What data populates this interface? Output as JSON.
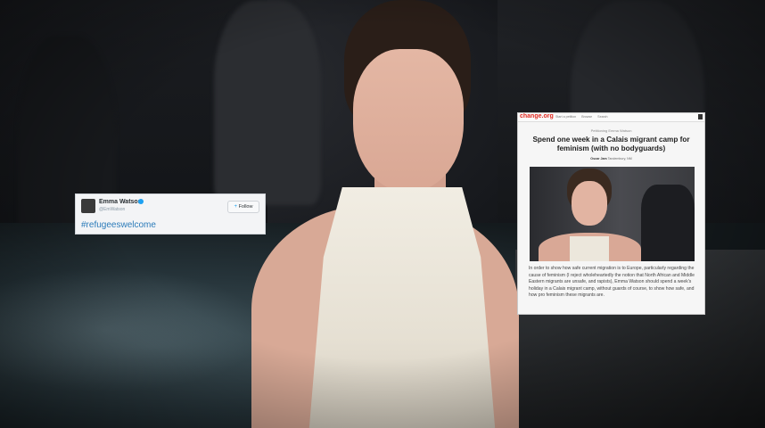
{
  "tweet": {
    "name": "Emma Watson",
    "handle": "@EmWatson",
    "follow_label": "Follow",
    "hashtag": "#refugeeswelcome",
    "accent": "#1da1f2"
  },
  "petition": {
    "logo": "change.org",
    "nav_links": [
      "Start a petition",
      "Browse",
      "Search"
    ],
    "tag": "Petitioning Emma Watson",
    "title": "Spend one week in a Calais migrant camp for feminism (with no bodyguards)",
    "author_name": "Oscar Jam",
    "author_location": "Tandembury, NM",
    "body": "In order to show how safe current migration is to Europe, particularly regarding the cause of feminism (I reject wholeheartedly the notion that North African and Middle Eastern migrants are unsafe, and rapists), Emma Watson should spend a week's holiday in a Calais migrant camp, without guards of course, to show how safe, and how pro feminism these migrants are.",
    "logo_color": "#e0281f"
  }
}
